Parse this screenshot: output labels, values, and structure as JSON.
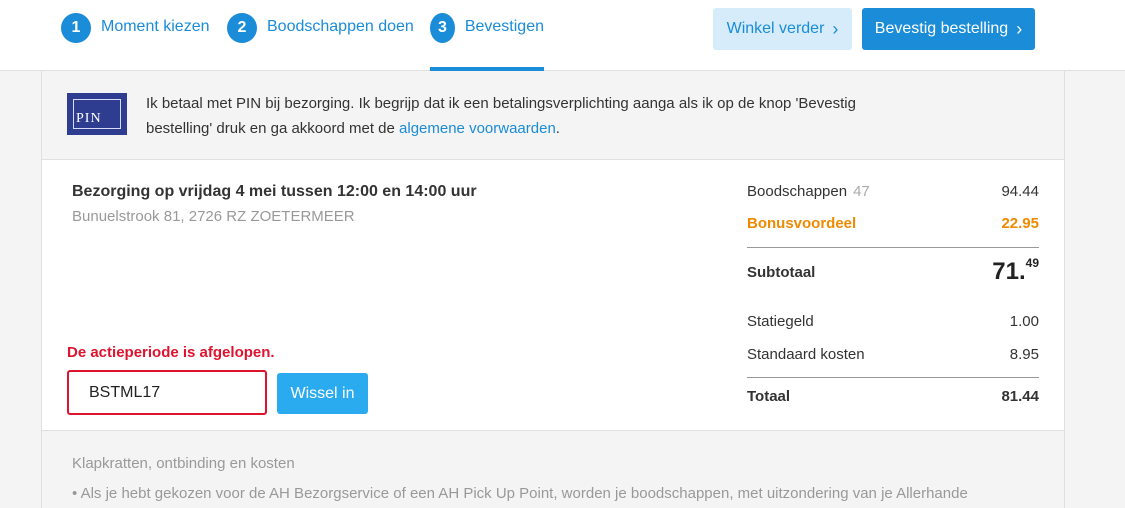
{
  "steps": [
    {
      "num": "1",
      "label": "Moment kiezen"
    },
    {
      "num": "2",
      "label": "Boodschappen doen"
    },
    {
      "num": "3",
      "label": "Bevestigen"
    }
  ],
  "header": {
    "continue_label": "Winkel verder",
    "confirm_label": "Bevestig bestelling"
  },
  "payment": {
    "logo_text": "PIN",
    "text": "Ik betaal met PIN bij bezorging. Ik begrijp dat ik een betalingsverplichting aanga als ik op de knop 'Bevestig bestelling' druk en ga akkoord met de ",
    "link_text": "algemene voorwaarden",
    "text_end": "."
  },
  "delivery": {
    "title": "Bezorging op vrijdag 4 mei tussen 12:00 en 14:00 uur",
    "address": "Bunuelstrook 81, 2726 RZ ZOETERMEER"
  },
  "promo": {
    "error": "De actieperiode is afgelopen.",
    "code": "BSTML17",
    "redeem_label": "Wissel in"
  },
  "summary": {
    "groceries_label": "Boodschappen",
    "groceries_count": "47",
    "groceries_value": "94.44",
    "bonus_label": "Bonusvoordeel",
    "bonus_value": "22.95",
    "subtotal_label": "Subtotaal",
    "subtotal_whole": "71.",
    "subtotal_cents": "49",
    "deposit_label": "Statiegeld",
    "deposit_value": "1.00",
    "standard_label": "Standaard kosten",
    "standard_value": "8.95",
    "total_label": "Totaal",
    "total_value": "81.44"
  },
  "footer": {
    "title": "Klapkratten, ontbinding en kosten",
    "bullet": "Als je hebt gekozen voor de AH Bezorgservice of een AH Pick Up Point, worden je boodschappen, met uitzondering van je Allerhande"
  },
  "colors": {
    "accent": "#1a8cd8",
    "error": "#e0132f",
    "bonus": "#f08a00"
  }
}
